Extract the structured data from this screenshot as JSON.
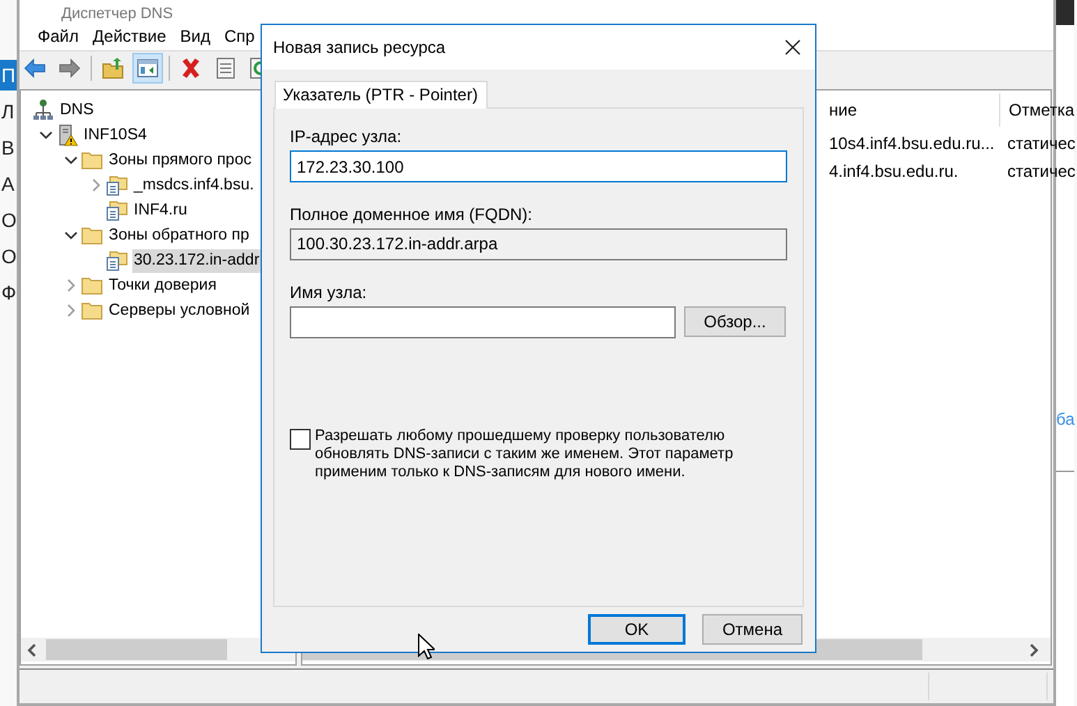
{
  "background_window": {
    "edge_texts": [
      {
        "text": "П",
        "selected": true
      },
      {
        "text": "Л",
        "selected": false
      },
      {
        "text": "В",
        "selected": false
      },
      {
        "text": "А",
        "selected": false
      },
      {
        "text": "О",
        "selected": false
      },
      {
        "text": "О",
        "selected": false
      },
      {
        "text": "Ф",
        "selected": false
      }
    ],
    "link_text": "ба"
  },
  "window": {
    "title": "Диспетчер DNS",
    "menu": [
      "Файл",
      "Действие",
      "Вид",
      "Спр"
    ]
  },
  "toolbar": [
    {
      "kind": "back"
    },
    {
      "kind": "forward"
    },
    {
      "kind": "up"
    },
    {
      "kind": "tree"
    },
    {
      "kind": "delete"
    },
    {
      "kind": "properties"
    },
    {
      "kind": "refresh"
    }
  ],
  "tree": [
    {
      "label": "DNS",
      "kind": "dns",
      "selected": false,
      "children": [
        {
          "label": "INF10S4",
          "kind": "server",
          "expanded": true,
          "selected": false,
          "children": [
            {
              "label": "Зоны прямого прос",
              "kind": "folder",
              "expanded": true,
              "selected": false,
              "children": [
                {
                  "label": "_msdcs.inf4.bsu.",
                  "kind": "zone",
                  "expanded": false,
                  "selected": false
                },
                {
                  "label": "INF4.ru",
                  "kind": "zone",
                  "selected": false
                }
              ]
            },
            {
              "label": "Зоны обратного пр",
              "kind": "folder",
              "expanded": true,
              "selected": false,
              "children": [
                {
                  "label": "30.23.172.in-addr",
                  "kind": "zone",
                  "selected": true
                }
              ]
            },
            {
              "label": "Точки доверия",
              "kind": "folder",
              "expanded": false,
              "selected": false
            },
            {
              "label": "Серверы условной",
              "kind": "folder",
              "expanded": false,
              "selected": false
            }
          ]
        }
      ]
    }
  ],
  "list": {
    "columns": [
      "ние",
      "Отметка"
    ],
    "rows": [
      [
        "10s4.inf4.bsu.edu.ru...",
        "статичес"
      ],
      [
        "4.inf4.bsu.edu.ru.",
        "статичес"
      ]
    ]
  },
  "dialog": {
    "title": "Новая запись ресурса",
    "tabs": [
      {
        "label": "Указатель (PTR - Pointer)",
        "selected": true
      }
    ],
    "ip_label": "IP-адрес узла:",
    "ip_value": "172.23.30.100",
    "fqdn_label": "Полное доменное имя (FQDN):",
    "fqdn_value": "100.30.23.172.in-addr.arpa",
    "host_label": "Имя узла:",
    "browse_button": "Обзор...",
    "allow_update": {
      "label": "Разрешать любому прошедшему проверку пользователю обновлять DNS-записи с таким же именем. Этот параметр применим только к DNS-записям для нового имени.",
      "checked": false
    },
    "buttons": [
      {
        "label": "OK",
        "default": true
      },
      {
        "label": "Отмена",
        "default": false
      }
    ]
  }
}
